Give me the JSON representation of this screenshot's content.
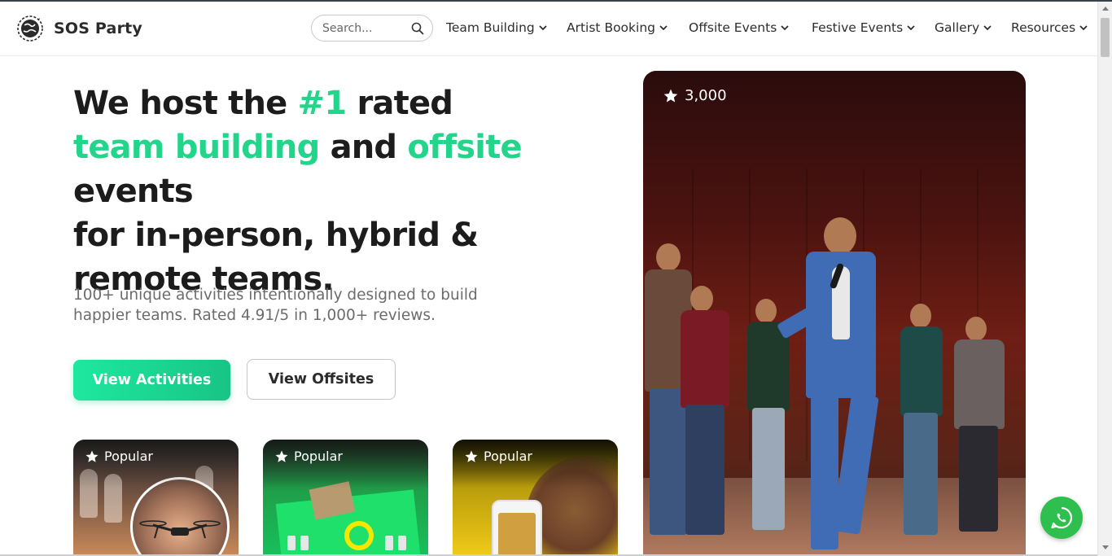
{
  "header": {
    "brand": "SOS Party",
    "search_placeholder": "Search...",
    "nav": [
      {
        "label": "Team Building"
      },
      {
        "label": "Artist Booking"
      },
      {
        "label": "Offsite Events"
      },
      {
        "label": "Festive Events"
      },
      {
        "label": "Gallery"
      },
      {
        "label": "Resources"
      }
    ]
  },
  "hero": {
    "title_parts": {
      "p1": "We host the ",
      "p2": "#1",
      "p3": " rated",
      "p4": "team building",
      "p5": " and ",
      "p6": "offsite",
      "p7": " events",
      "p8": "for in-person, hybrid & remote teams."
    },
    "subtitle": "100+ unique activities intentionally designed to build happier teams. Rated 4.91/5 in 1,000+ reviews.",
    "primary_button": "View Activities",
    "secondary_button": "View Offsites",
    "photo_rating": "3,000"
  },
  "cards": [
    {
      "badge": "Popular"
    },
    {
      "badge": "Popular"
    },
    {
      "badge": "Popular"
    }
  ],
  "colors": {
    "accent": "#22d58a",
    "text": "#1c1c1c",
    "subtext": "#6c6c6c",
    "whatsapp": "#2fbf4f"
  },
  "icons": {
    "logo": "globe-icon",
    "search": "search-icon",
    "chevron": "chevron-down-icon",
    "star": "star-icon",
    "whatsapp": "whatsapp-icon"
  }
}
